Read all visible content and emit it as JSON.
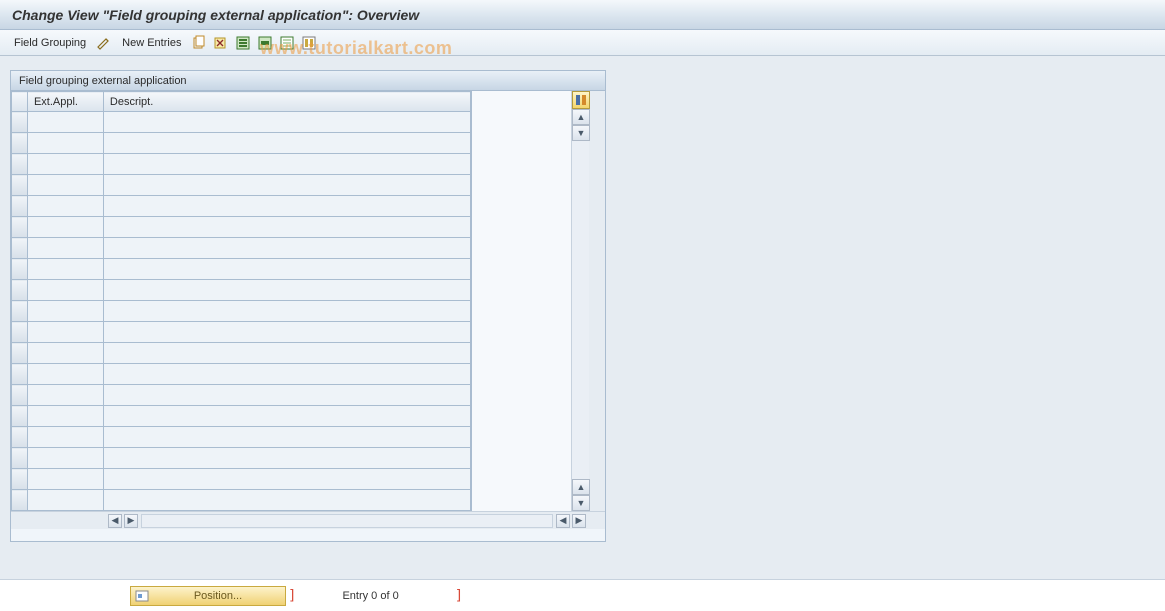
{
  "title": "Change View \"Field grouping external application\": Overview",
  "toolbar": {
    "field_grouping_label": "Field Grouping",
    "new_entries_label": "New Entries"
  },
  "panel": {
    "header": "Field grouping external application",
    "columns": {
      "col1": "Ext.Appl.",
      "col2": "Descript."
    }
  },
  "status": {
    "position_label": "Position...",
    "entry_label": "Entry 0 of 0"
  },
  "watermark": "www.tutorialkart.com"
}
